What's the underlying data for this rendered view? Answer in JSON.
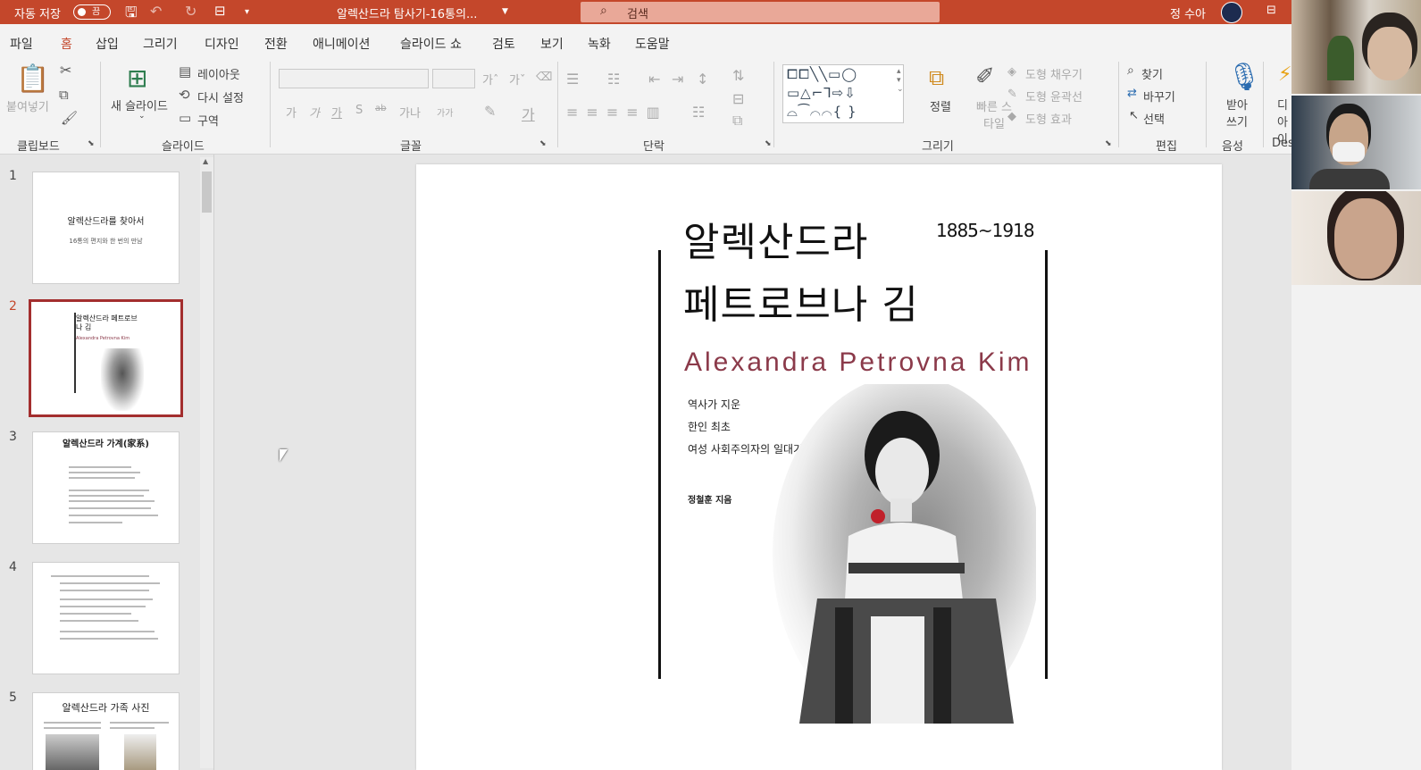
{
  "titlebar": {
    "autosave_label": "자동 저장",
    "autosave_state": "끔",
    "doc_title": "알렉산드라 탐사기-16통의...",
    "search_placeholder": "검색",
    "user_name": "정 수아"
  },
  "menu": [
    "파일",
    "홈",
    "삽입",
    "그리기",
    "디자인",
    "전환",
    "애니메이션",
    "슬라이드 쇼",
    "검토",
    "보기",
    "녹화",
    "도움말"
  ],
  "ribbon": {
    "clipboard": {
      "paste": "붙여넣기",
      "group": "클립보드"
    },
    "slides": {
      "new_slide": "새 슬라이드",
      "layout": "레이아웃",
      "reset": "다시 설정",
      "section": "구역",
      "group": "슬라이드"
    },
    "font": {
      "group": "글꼴",
      "buttons": [
        "가",
        "가",
        "가",
        "S",
        "ab",
        "가나",
        "가가"
      ]
    },
    "paragraph": {
      "group": "단락"
    },
    "drawing": {
      "arrange": "정렬",
      "quick_styles": "빠른 스타일",
      "fill": "도형 채우기",
      "outline": "도형 윤곽선",
      "effects": "도형 효과",
      "group": "그리기"
    },
    "editing": {
      "find": "찾기",
      "replace": "바꾸기",
      "select": "선택",
      "group": "편집"
    },
    "voice": {
      "dictate": "받아 쓰기",
      "group": "음성"
    },
    "designer": {
      "label": "디 아이",
      "group": "Des"
    }
  },
  "thumbnails": [
    {
      "num": "1",
      "title": "알렉산드라를 찾아서",
      "subtitle": "16통의 편지와 한 번의 만남"
    },
    {
      "num": "2",
      "title": "알렉산드라 페트로브나 김",
      "subtitle": "Alexandra Petrovna Kim"
    },
    {
      "num": "3",
      "title": "알렉산드라 가계(家系)",
      "subtitle": ""
    },
    {
      "num": "4",
      "title": "",
      "subtitle": ""
    },
    {
      "num": "5",
      "title": "알렉산드라 가족 사진",
      "subtitle": ""
    }
  ],
  "slide": {
    "title_line1": "알렉산드라",
    "title_line2": "페트로브나 김",
    "years": "1885~1918",
    "english_name": "Alexandra Petrovna Kim",
    "subtitle_lines": [
      "역사가 지운",
      "한인 최초",
      "여성 사회주의자의 일대기"
    ],
    "author": "정철훈 지음"
  },
  "colors": {
    "accent": "#c4472b",
    "title_red": "#8b3a4a",
    "selected_thumb": "#a32e2e"
  }
}
